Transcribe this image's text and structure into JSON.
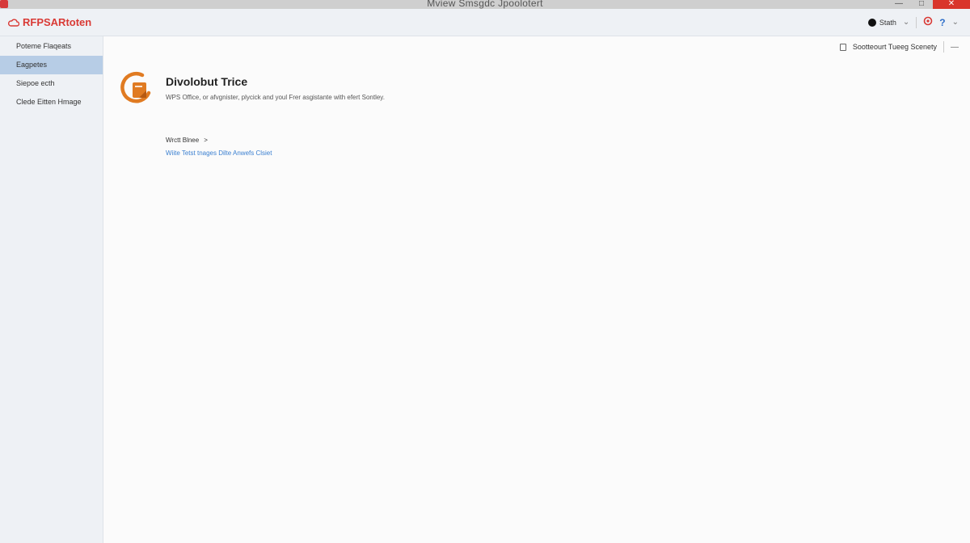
{
  "window": {
    "title": "Mview Smsgdc Jpoolotert",
    "minimize": "—",
    "maximize": "□",
    "close": "✕"
  },
  "header": {
    "brand": "RFPSARtoten",
    "user_label": "Stath",
    "chevron": "⌄",
    "help_icon": "?"
  },
  "sidebar": {
    "items": [
      {
        "label": "Poteme Flaqeats"
      },
      {
        "label": "Eagpetes"
      },
      {
        "label": "Siepoe ecth"
      },
      {
        "label": "Clede Eitten Hmage"
      }
    ]
  },
  "main": {
    "toolbar_label": "Sootteourt Tueeg Scenety",
    "toolbar_menu": "—",
    "title": "Divolobut Trice",
    "description": "WPS Office, or afvgnister, plycick and youl Frer asgistante with efert Sontley.",
    "watch_label": "Wrctt Blnee",
    "watch_arrow": ">",
    "blue_link": "Wiite Tetst tnages Dilte Anwefs Clsiet"
  },
  "colors": {
    "brand": "#d93a35",
    "accent": "#e07b22",
    "sidebar_active": "#b7cde6",
    "link": "#3a7fd0"
  },
  "icons": {
    "brand": "cloud-icon",
    "hero": "office-icon",
    "user": "user-dot-icon",
    "notifications": "alert-icon",
    "help": "help-icon"
  }
}
